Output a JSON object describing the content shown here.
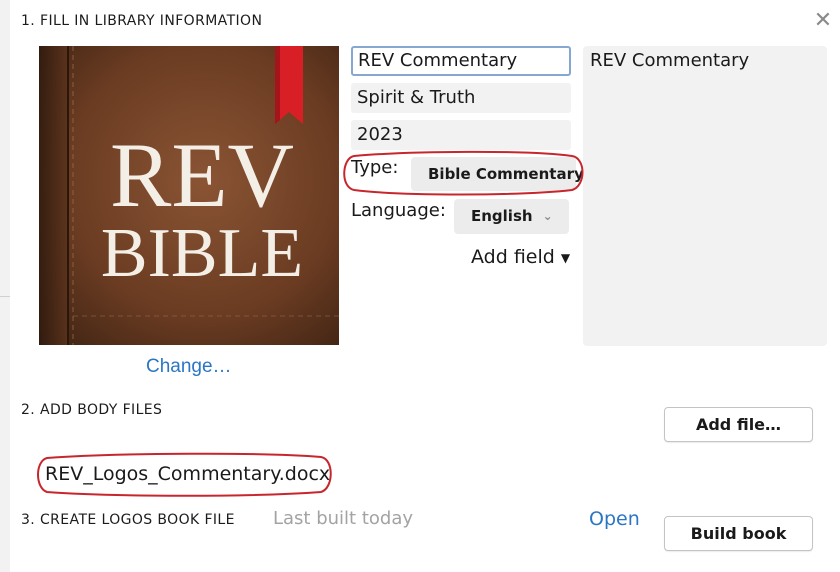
{
  "section1": {
    "heading": "1. FILL IN LIBRARY INFORMATION"
  },
  "cover": {
    "line1": "REV",
    "line2": "BIBLE",
    "change_label": "Change…"
  },
  "fields": {
    "title": "REV Commentary",
    "author": "Spirit & Truth",
    "year": "2023",
    "type_label": "Type:",
    "type_value": "Bible Commentary",
    "language_label": "Language:",
    "language_value": "English",
    "add_field_label": "Add field"
  },
  "preview": {
    "text": "REV Commentary"
  },
  "section2": {
    "heading": "2. ADD BODY FILES",
    "add_file_label": "Add file…",
    "files": [
      "REV_Logos_Commentary.docx"
    ]
  },
  "section3": {
    "heading": "3. CREATE LOGOS BOOK FILE",
    "status": "Last built today",
    "open_label": "Open",
    "build_label": "Build book"
  },
  "colors": {
    "link": "#2a76c5",
    "annotation": "#c8262d",
    "cover_leather": "#6b3c22",
    "ribbon": "#d91f26"
  },
  "icons": {
    "close": "close-icon",
    "language_dropdown": "chevron-down-icon",
    "add_field_dropdown": "caret-down-icon"
  }
}
